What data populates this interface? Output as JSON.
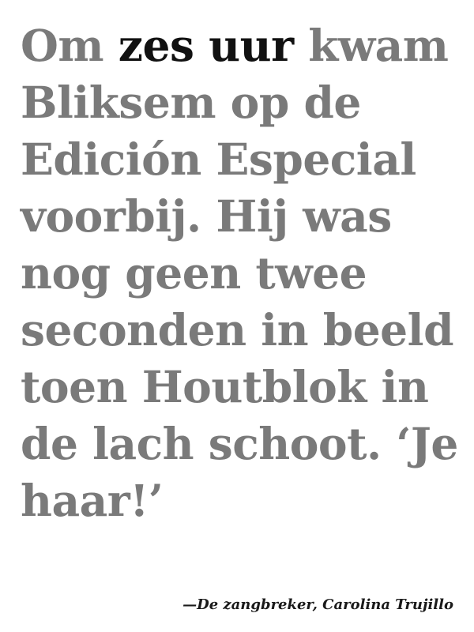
{
  "quote": {
    "lead": "Om ",
    "highlight": "zes uur",
    "rest": " kwam Bliksem op de Edición Especial voorbij. Hij was nog geen twee seconden in beeld toen Houtblok in de lach schoot. ‘Je haar!’"
  },
  "attribution": "—De zangbreker, Carolina Trujillo",
  "colors": {
    "background": "#ffffff",
    "quote_text": "#7a7a7a",
    "highlight_text": "#111111",
    "attribution_text": "#1a1a1a"
  }
}
